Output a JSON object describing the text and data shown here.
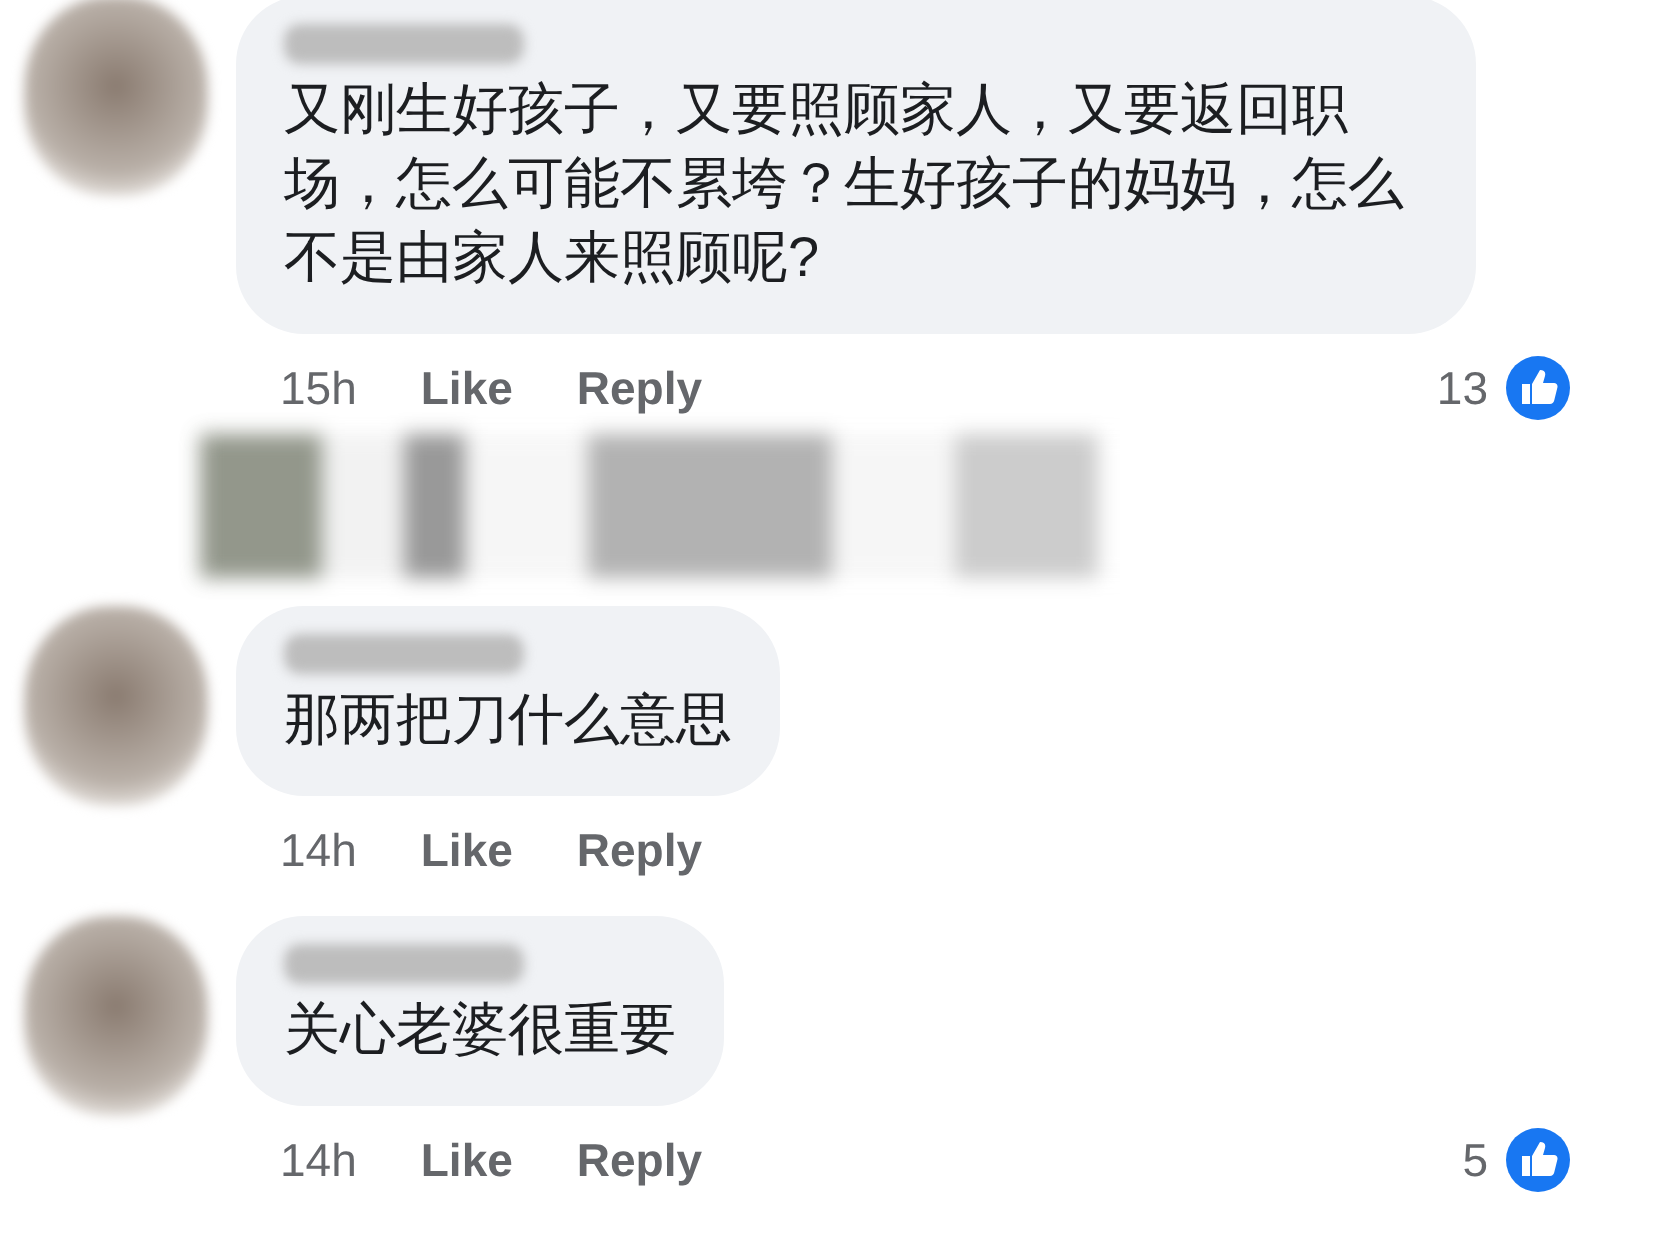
{
  "items": [
    {
      "kind": "comment",
      "text": "又刚生好孩子，又要照顾家人，又要返回职场，怎么可能不累垮？生好孩子的妈妈，怎么不是由家人来照顾呢?",
      "time": "15h",
      "like": "Like",
      "reply": "Reply",
      "reactions": "13"
    },
    {
      "kind": "redacted"
    },
    {
      "kind": "comment",
      "text": "那两把刀什么意思",
      "time": "14h",
      "like": "Like",
      "reply": "Reply"
    },
    {
      "kind": "comment",
      "text": "关心老婆很重要",
      "time": "14h",
      "like": "Like",
      "reply": "Reply",
      "reactions": "5"
    }
  ]
}
